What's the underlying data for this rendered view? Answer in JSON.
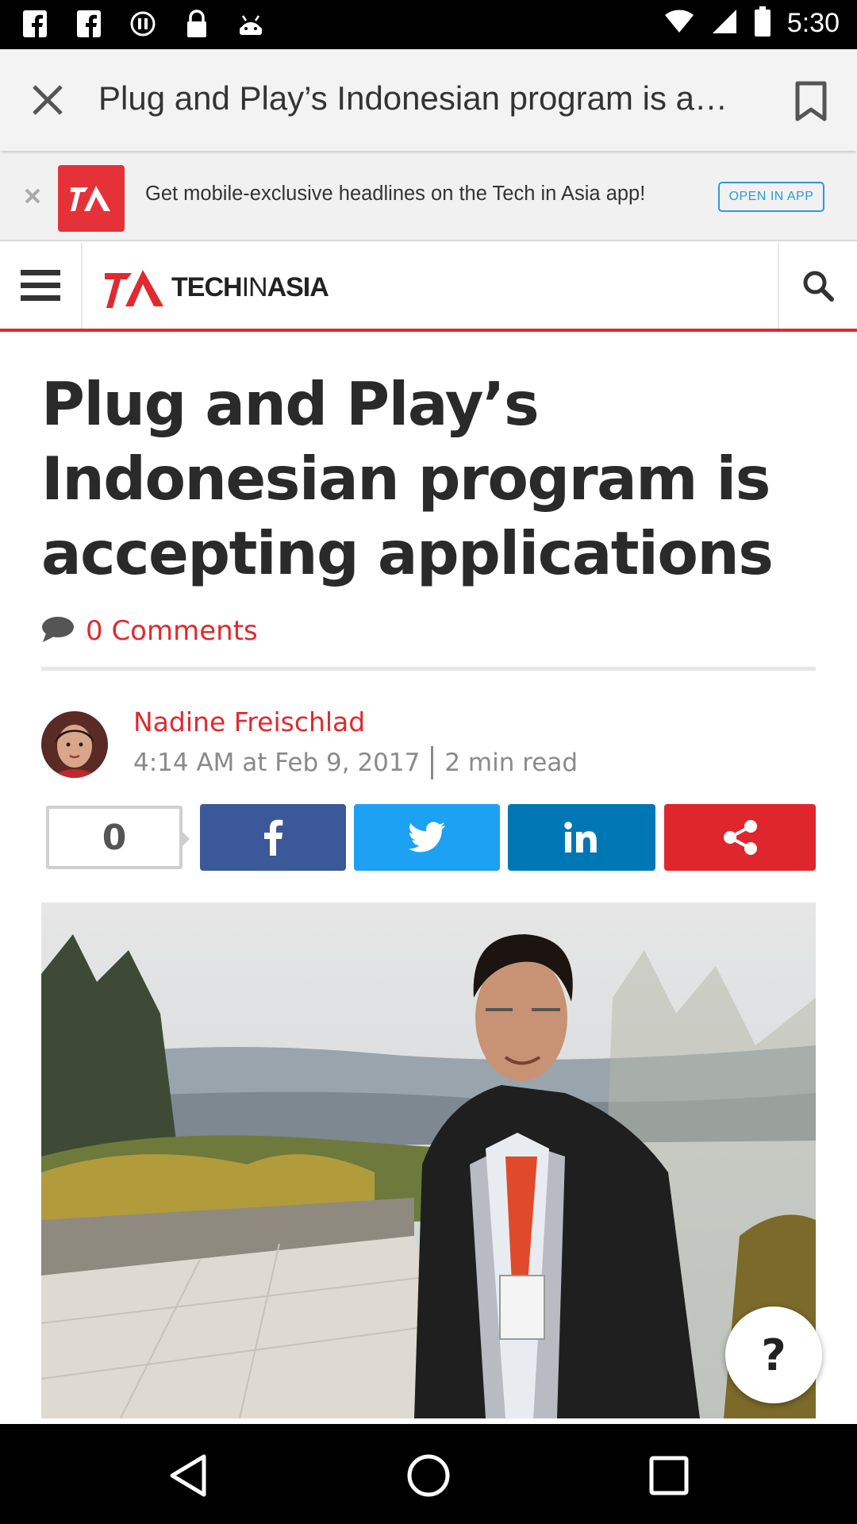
{
  "status_bar": {
    "time": "5:30",
    "icons": [
      "facebook-icon",
      "facebook-icon",
      "cast-icon",
      "lock-icon",
      "android-icon"
    ],
    "right_icons": [
      "wifi-icon",
      "signal-icon",
      "battery-icon"
    ]
  },
  "browser_tab": {
    "title": "Plug and Play’s Indonesian program is accepting applications",
    "close_icon": "close-icon",
    "bookmark_icon": "bookmark-icon"
  },
  "app_banner": {
    "text": "Get mobile-exclusive headlines on the Tech in Asia app!",
    "open_button": "OPEN IN APP"
  },
  "site_header": {
    "logo_bold_1": "TECH",
    "logo_thin": "IN",
    "logo_bold_2": "ASIA",
    "accent_color": "#e02a2f"
  },
  "article": {
    "title": "Plug and Play’s Indonesian program is accepting applications",
    "comments": "0  Comments",
    "author": "Nadine Freischlad",
    "timestamp": "4:14 AM at Feb 9, 2017",
    "read_time": "2 min read",
    "share_count": "0"
  },
  "share_buttons": [
    {
      "name": "facebook",
      "color": "#3b5998"
    },
    {
      "name": "twitter",
      "color": "#1da1f2"
    },
    {
      "name": "linkedin",
      "color": "#0077b5"
    },
    {
      "name": "share",
      "color": "#e0262d"
    }
  ],
  "help_button": "?"
}
